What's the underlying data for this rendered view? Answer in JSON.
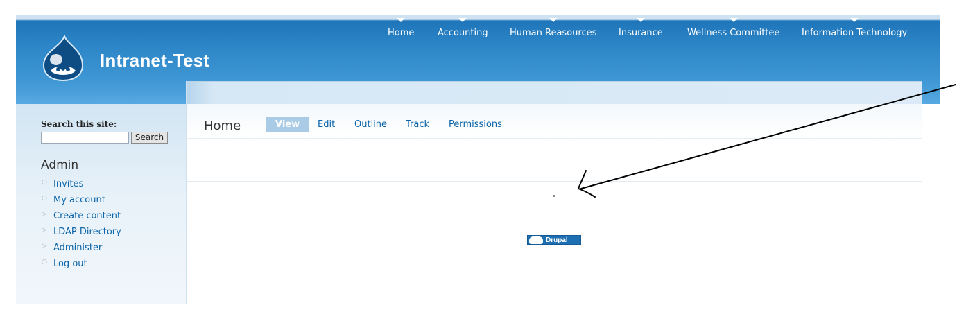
{
  "site": {
    "name": "Intranet-Test"
  },
  "primary_nav": [
    {
      "label": "Home"
    },
    {
      "label": "Accounting"
    },
    {
      "label": "Human Reasources"
    },
    {
      "label": "Insurance"
    },
    {
      "label": "Wellness Committee"
    },
    {
      "label": "Information Technology"
    }
  ],
  "search": {
    "label": "Search this site:",
    "value": "",
    "button": "Search"
  },
  "admin": {
    "title": "Admin",
    "items": [
      {
        "label": "Invites",
        "icon": "circle-bullet-icon"
      },
      {
        "label": "My account",
        "icon": "circle-bullet-icon"
      },
      {
        "label": "Create content",
        "icon": "triangle-right-icon"
      },
      {
        "label": "LDAP Directory",
        "icon": "triangle-right-icon"
      },
      {
        "label": "Administer",
        "icon": "triangle-right-icon"
      },
      {
        "label": "Log out",
        "icon": "circle-bullet-icon"
      }
    ]
  },
  "page": {
    "title": "Home",
    "tabs": [
      {
        "label": "View",
        "active": true
      },
      {
        "label": "Edit"
      },
      {
        "label": "Outline"
      },
      {
        "label": "Track"
      },
      {
        "label": "Permissions"
      }
    ]
  },
  "footer": {
    "badge_text": "Drupal"
  },
  "colors": {
    "header_blue": "#2b84c6",
    "link": "#0b64a8",
    "active_tab": "#a9cbe6"
  }
}
